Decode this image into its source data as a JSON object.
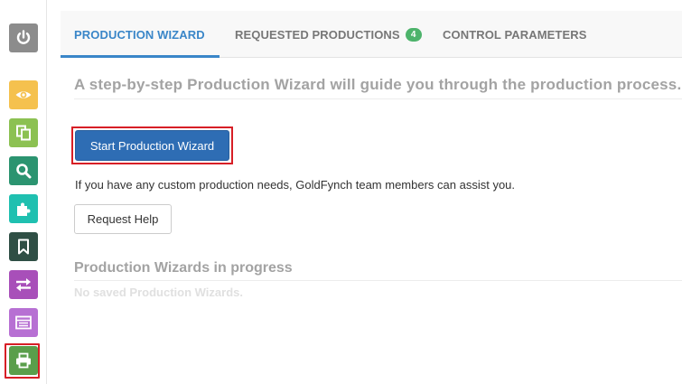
{
  "sidebar": {
    "items": [
      {
        "icon": "power-icon",
        "color": "#8c8c8c"
      },
      {
        "icon": "eye-icon",
        "color": "#f5c14e"
      },
      {
        "icon": "copy-documents-icon",
        "color": "#8cc152"
      },
      {
        "icon": "search-icon",
        "color": "#2b9470"
      },
      {
        "icon": "puzzle-icon",
        "color": "#1fc0b0"
      },
      {
        "icon": "bookmark-icon",
        "color": "#2f4f45"
      },
      {
        "icon": "transfer-arrows-icon",
        "color": "#a84fb9"
      },
      {
        "icon": "table-list-icon",
        "color": "#b770d3"
      },
      {
        "icon": "printer-icon",
        "color": "#5a9e4b",
        "selected": true
      }
    ]
  },
  "tabs": [
    {
      "label": "PRODUCTION WIZARD",
      "active": true
    },
    {
      "label": "REQUESTED PRODUCTIONS",
      "badge": "4"
    },
    {
      "label": "CONTROL PARAMETERS"
    }
  ],
  "main": {
    "heading": "A step-by-step Production Wizard will guide you through the production process.",
    "start_button": "Start Production Wizard",
    "help_text": "If you have any custom production needs, GoldFynch team members can assist you.",
    "help_button": "Request Help",
    "in_progress_heading": "Production Wizards in progress",
    "empty_text": "No saved Production Wizards."
  },
  "colors": {
    "accent": "#3a86c8",
    "primary_button": "#2e6db4",
    "badge": "#4db36b",
    "highlight": "#d71f26"
  }
}
